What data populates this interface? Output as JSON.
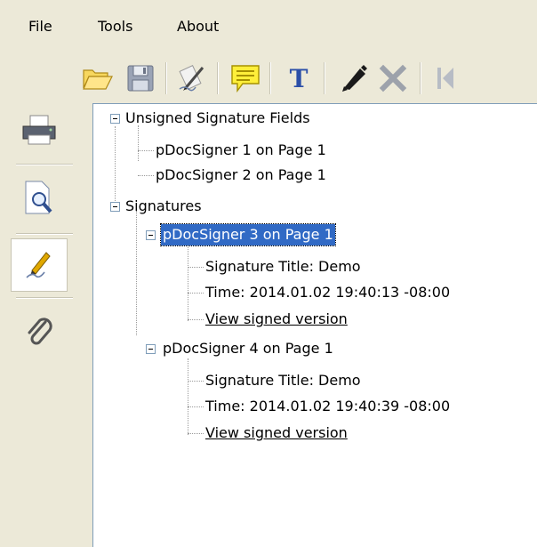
{
  "menu": {
    "file": "File",
    "tools": "Tools",
    "about": "About"
  },
  "toolbar": {
    "buttons": [
      "open-folder-icon",
      "save-disk-icon",
      "sign-pen-icon",
      "comment-icon",
      "text-icon",
      "pencil-icon",
      "delete-x-icon",
      "first-page-icon"
    ]
  },
  "sidebar": {
    "items": [
      "printer-icon",
      "preview-magnifier-icon",
      "signature-pen-icon",
      "attachment-paperclip-icon"
    ],
    "active_index": 2
  },
  "tree": {
    "unsigned_fields": {
      "label": "Unsigned Signature Fields",
      "children": [
        "pDocSigner 1 on Page 1",
        "pDocSigner 2 on Page 1"
      ]
    },
    "signatures": {
      "label": "Signatures",
      "sig3": {
        "label": "pDocSigner 3 on Page 1",
        "title": "Signature Title: Demo",
        "time": "Time: 2014.01.02 19:40:13 -08:00",
        "link": "View signed version"
      },
      "sig4": {
        "label": "pDocSigner 4 on Page 1",
        "title": "Signature Title: Demo",
        "time": "Time: 2014.01.02 19:40:39 -08:00",
        "link": "View signed version"
      }
    }
  },
  "colors": {
    "window_bg": "#ece9d8",
    "selection": "#316ac5",
    "tree_lines": "#9a9a9a"
  }
}
